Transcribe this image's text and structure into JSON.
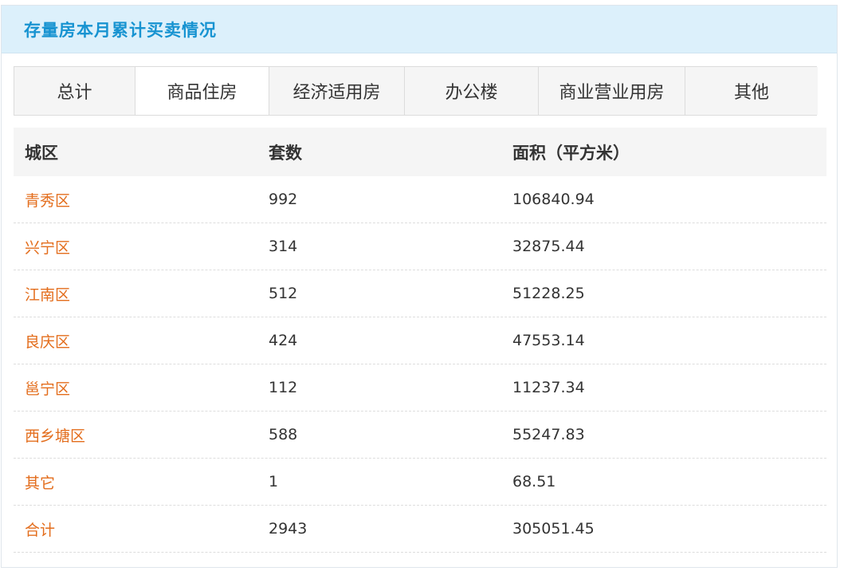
{
  "panel": {
    "title": "存量房本月累计买卖情况"
  },
  "tabs": [
    {
      "label": "总计"
    },
    {
      "label": "商品住房"
    },
    {
      "label": "经济适用房"
    },
    {
      "label": "办公楼"
    },
    {
      "label": "商业营业用房"
    },
    {
      "label": "其他"
    }
  ],
  "active_tab": "商品住房",
  "table": {
    "headers": [
      "城区",
      "套数",
      "面积（平方米）"
    ],
    "rows": [
      {
        "district": "青秀区",
        "units": "992",
        "area": "106840.94"
      },
      {
        "district": "兴宁区",
        "units": "314",
        "area": "32875.44"
      },
      {
        "district": "江南区",
        "units": "512",
        "area": "51228.25"
      },
      {
        "district": "良庆区",
        "units": "424",
        "area": "47553.14"
      },
      {
        "district": "邕宁区",
        "units": "112",
        "area": "11237.34"
      },
      {
        "district": "西乡塘区",
        "units": "588",
        "area": "55247.83"
      },
      {
        "district": "其它",
        "units": "1",
        "area": "68.51"
      },
      {
        "district": "合计",
        "units": "2943",
        "area": "305051.45"
      }
    ]
  },
  "colors": {
    "title": "#1793d1",
    "header_bg": "#dcf0fb",
    "district_link": "#e36d1c"
  }
}
